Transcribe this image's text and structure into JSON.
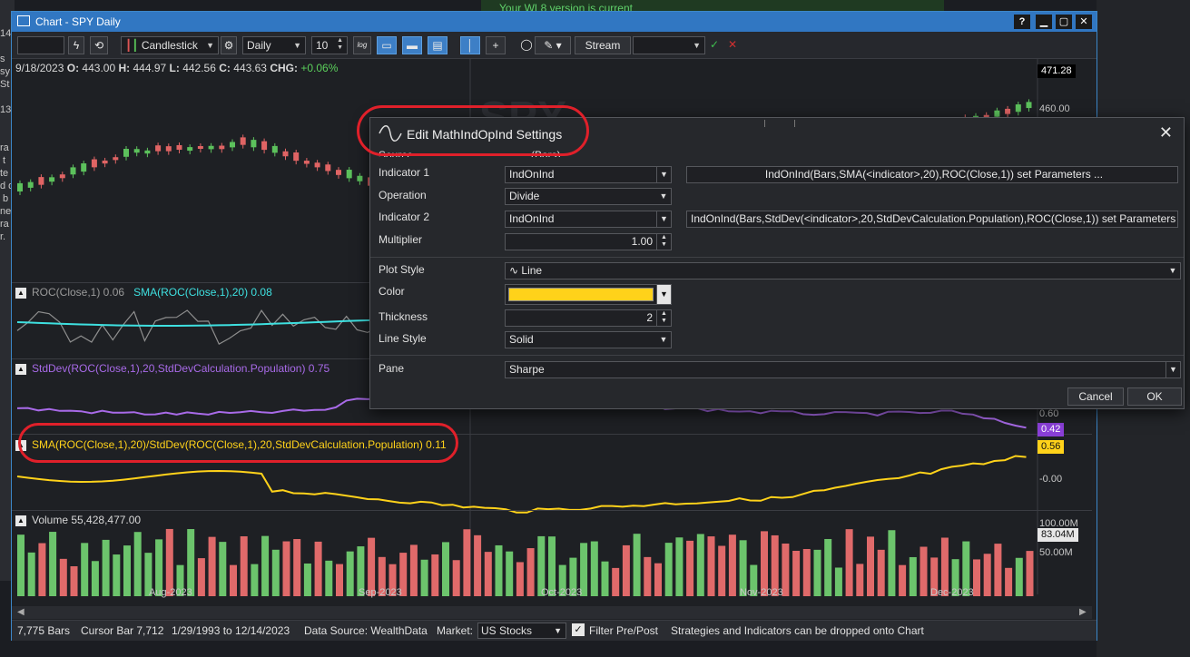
{
  "window": {
    "title": "Chart - SPY Daily"
  },
  "background": {
    "banner": "Your WL8 version is current",
    "left_text": "14\n\ns \nsy\nSt\n\n13\n\n\nra\n t\nte\nd d\n b\nne\nra\nr."
  },
  "toolbar": {
    "symbol_value": "",
    "chart_style": "Candlestick",
    "scale": "Daily",
    "bars_value": "10",
    "log_label": "log",
    "stream_label": "Stream",
    "check_icon": "✓",
    "cancel_icon": "✕"
  },
  "price_pane": {
    "info": "9/18/2023",
    "o_label": "O:",
    "o": "443.00",
    "h_label": "H:",
    "h": "444.97",
    "l_label": "L:",
    "l": "442.56",
    "c_label": "C:",
    "c": "443.63",
    "chg_label": "CHG:",
    "chg": "+0.06%",
    "last_price": "471.28",
    "axis_460": "460.00",
    "watermark": "SPY"
  },
  "roc_pane": {
    "roc_label": "ROC(Close,1) 0.06",
    "sma_label": "SMA(ROC(Close,1),20) 0.08"
  },
  "std_pane": {
    "label": "StdDev(ROC(Close,1),20,StdDevCalculation.Population) 0.75",
    "axis_060": "0.60",
    "tag": "0.42"
  },
  "sharpe_pane": {
    "label": "SMA(ROC(Close,1),20)/StdDev(ROC(Close,1),20,StdDevCalculation.Population) 0.11",
    "tag": "0.56",
    "axis_0": "-0.00"
  },
  "volume_pane": {
    "label": "Volume 55,428,477.00",
    "axis_100": "100.00M",
    "tag": "83.04M",
    "axis_50": "50.00M"
  },
  "xaxis": [
    "Aug-2023",
    "Sep-2023",
    "Oct-2023",
    "Nov-2023",
    "Dec-2023"
  ],
  "status": {
    "bars": "7,775 Bars",
    "cursor": "Cursor Bar 7,712",
    "range": "1/29/1993 to 12/14/2023",
    "source": "Data Source: WealthData",
    "market_label": "Market:",
    "market_value": "US Stocks",
    "filter_label": "Filter Pre/Post",
    "hint": "Strategies and Indicators can be dropped onto Chart"
  },
  "dialog": {
    "title": "Edit MathIndOpInd Settings",
    "source_label": "Source",
    "source_value": "(Bars)",
    "indicator1_label": "Indicator 1",
    "indicator1_value": "IndOnInd",
    "indicator1_params": "IndOnInd(Bars,SMA(<indicator>,20),ROC(Close,1)) set Parameters ...",
    "operation_label": "Operation",
    "operation_value": "Divide",
    "indicator2_label": "Indicator 2",
    "indicator2_value": "IndOnInd",
    "indicator2_params": "IndOnInd(Bars,StdDev(<indicator>,20,StdDevCalculation.Population),ROC(Close,1)) set Parameters ...",
    "multiplier_label": "Multiplier",
    "multiplier_value": "1.00",
    "plotstyle_label": "Plot Style",
    "plotstyle_value": "∿ Line",
    "color_label": "Color",
    "color_value": "#ffd21a",
    "thickness_label": "Thickness",
    "thickness_value": "2",
    "linestyle_label": "Line Style",
    "linestyle_value": "Solid",
    "pane_label": "Pane",
    "pane_value": "Sharpe",
    "cancel": "Cancel",
    "ok": "OK"
  }
}
